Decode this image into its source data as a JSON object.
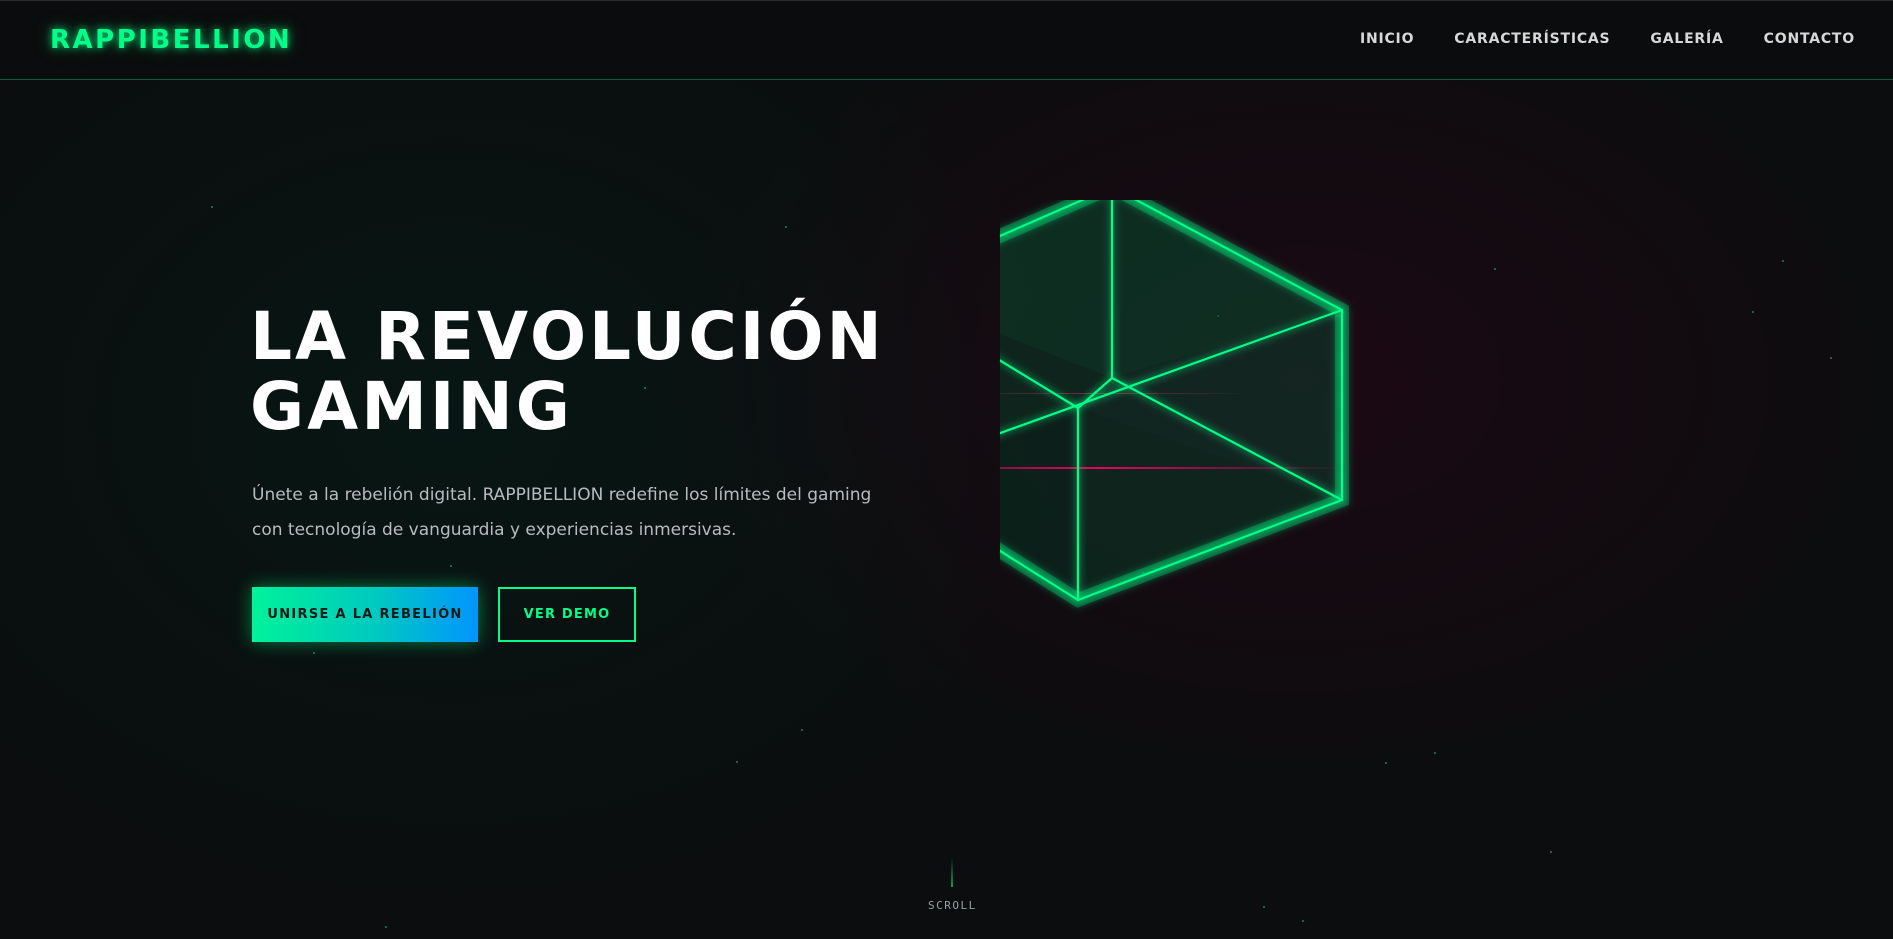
{
  "brand": {
    "logo": "RAPPIBELLION",
    "accent_color": "#00ff88",
    "secondary_accent": "#ff0066"
  },
  "nav": {
    "items": [
      {
        "label": "INICIO"
      },
      {
        "label": "CARACTERÍSTICAS"
      },
      {
        "label": "GALERÍA"
      },
      {
        "label": "CONTACTO"
      }
    ]
  },
  "hero": {
    "title_line1": "LA REVOLUCIÓN",
    "title_line2": "GAMING",
    "description": "Únete a la rebelión digital. RAPPIBELLION redefine los límites del gaming con tecnología de vanguardia y experiencias inmersivas.",
    "primary_button": "UNIRSE A LA REBELIÓN",
    "secondary_button": "VER DEMO",
    "graphic_icon": "wireframe-cube-icon"
  },
  "scroll": {
    "label": "SCROLL"
  }
}
